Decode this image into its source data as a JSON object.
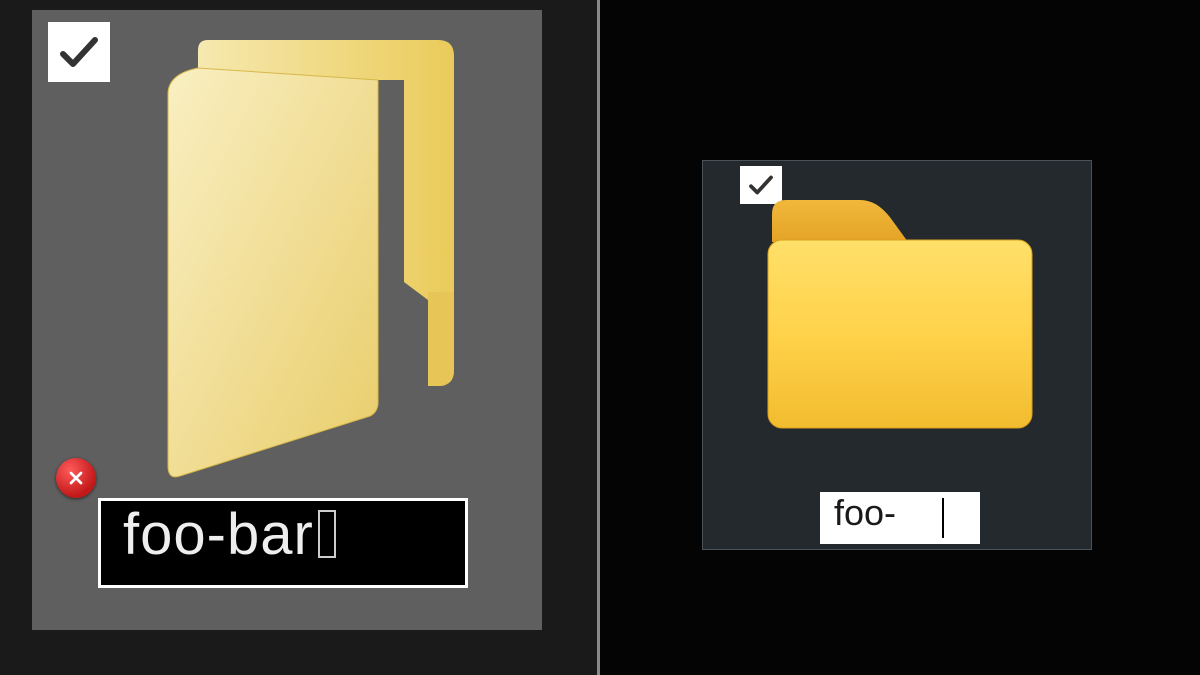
{
  "left": {
    "checkbox_checked": true,
    "folder_name_value": "foo-bar",
    "has_invalid_char_glyph": true,
    "error_badge": true
  },
  "right": {
    "checkbox_checked": true,
    "folder_name_value": "foo-"
  },
  "icons": {
    "checkmark": "check-icon",
    "error_x": "error-x-icon",
    "folder_open": "folder-open-icon",
    "folder_closed": "folder-closed-icon"
  },
  "colors": {
    "left_bg": "#1a1a1a",
    "left_tile": "#5f5f5f",
    "right_bg": "#040404",
    "right_tile": "#24292d",
    "folder_yellow_light": "#f4e4a1",
    "folder_yellow_dark": "#e6b73f",
    "error_red": "#c11818"
  }
}
